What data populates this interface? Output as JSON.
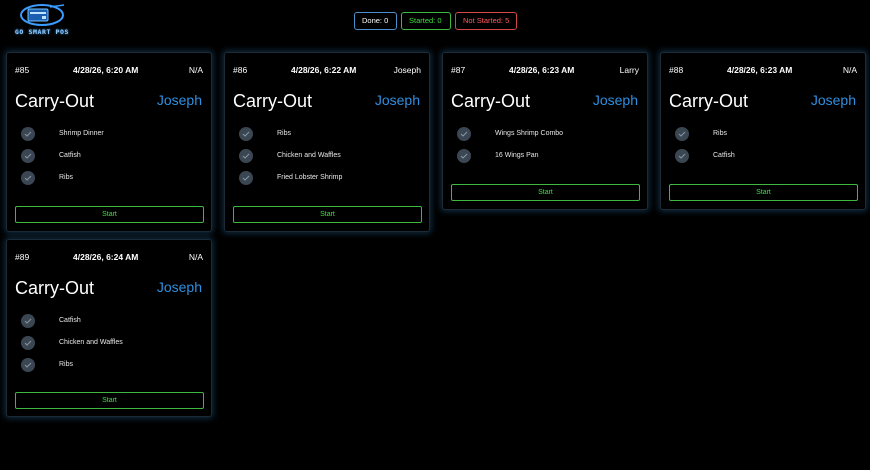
{
  "logo": {
    "text": "GO SMART POS"
  },
  "status": {
    "done": "Done: 0",
    "started": "Started: 0",
    "not_started": "Not Started: 5"
  },
  "colors": {
    "accent_blue": "#2f8fe0",
    "green": "#3fe03f",
    "red": "#ff5a5a"
  },
  "orders": [
    {
      "number": "#85",
      "time": "4/28/26, 6:20 AM",
      "server": "N/A",
      "type": "Carry-Out",
      "customer": "Joseph",
      "items": [
        "Shrimp Dinner",
        "Catfish",
        "Ribs"
      ],
      "action": "Start"
    },
    {
      "number": "#86",
      "time": "4/28/26, 6:22 AM",
      "server": "Joseph",
      "type": "Carry-Out",
      "customer": "Joseph",
      "items": [
        "Ribs",
        "Chicken and Waffles",
        "Fried Lobster Shrimp"
      ],
      "action": "Start"
    },
    {
      "number": "#87",
      "time": "4/28/26, 6:23 AM",
      "server": "Larry",
      "type": "Carry-Out",
      "customer": "Joseph",
      "items": [
        "Wings Shrimp Combo",
        "16 Wings Pan"
      ],
      "action": "Start"
    },
    {
      "number": "#88",
      "time": "4/28/26, 6:23 AM",
      "server": "N/A",
      "type": "Carry-Out",
      "customer": "Joseph",
      "items": [
        "Ribs",
        "Catfish"
      ],
      "action": "Start"
    },
    {
      "number": "#89",
      "time": "4/28/26, 6:24 AM",
      "server": "N/A",
      "type": "Carry-Out",
      "customer": "Joseph",
      "items": [
        "Catfish",
        "Chicken and Waffles",
        "Ribs"
      ],
      "action": "Start"
    }
  ]
}
